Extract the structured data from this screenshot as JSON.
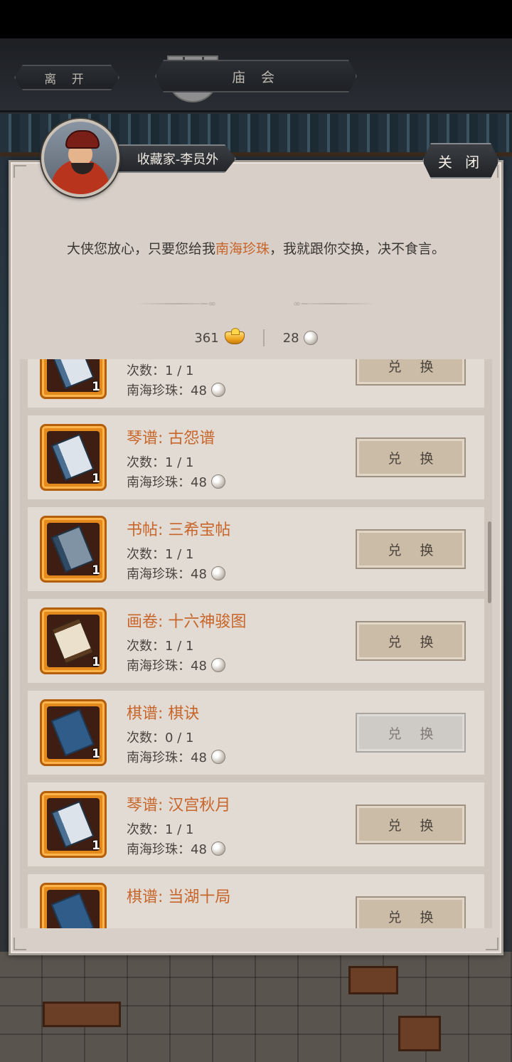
{
  "top_nav": {
    "leave_label": "离 开",
    "fair_label": "庙 会"
  },
  "npc": {
    "name": "收藏家-李员外",
    "dialogue_before": "大侠您放心，只要您给我",
    "dialogue_highlight": "南海珍珠",
    "dialogue_after": "，我就跟你交换，决不食言。"
  },
  "close_label": "关 闭",
  "currency": {
    "gold_ingot": "361",
    "pearl": "28",
    "gold_icon": "gold-ingot-icon",
    "pearl_icon": "pearl-icon"
  },
  "items": [
    {
      "title": "",
      "uses": "次数：1 / 1",
      "cost": "南海珍珠：48",
      "qty": "1",
      "button": "兑 换",
      "enabled": true,
      "art": "book"
    },
    {
      "title": "琴谱: 古怨谱",
      "uses": "次数：1 / 1",
      "cost": "南海珍珠：48",
      "qty": "1",
      "button": "兑 换",
      "enabled": true,
      "art": "book"
    },
    {
      "title": "书帖: 三希宝帖",
      "uses": "次数：1 / 1",
      "cost": "南海珍珠：48",
      "qty": "1",
      "button": "兑 换",
      "enabled": true,
      "art": "dark"
    },
    {
      "title": "画卷: 十六神骏图",
      "uses": "次数：1 / 1",
      "cost": "南海珍珠：48",
      "qty": "1",
      "button": "兑 换",
      "enabled": true,
      "art": "scroll"
    },
    {
      "title": "棋谱: 棋诀",
      "uses": "次数：0 / 1",
      "cost": "南海珍珠：48",
      "qty": "1",
      "button": "兑 换",
      "enabled": false,
      "art": "blue"
    },
    {
      "title": "琴谱: 汉宫秋月",
      "uses": "次数：1 / 1",
      "cost": "南海珍珠：48",
      "qty": "1",
      "button": "兑 换",
      "enabled": true,
      "art": "book"
    },
    {
      "title": "棋谱: 当湖十局",
      "uses": "",
      "cost": "",
      "qty": "",
      "button": "兑 换",
      "enabled": true,
      "art": "blue"
    }
  ],
  "colors": {
    "accent_orange": "#c8652a",
    "panel_bg": "#d7cfc8",
    "item_frame": "#e48a1c"
  }
}
